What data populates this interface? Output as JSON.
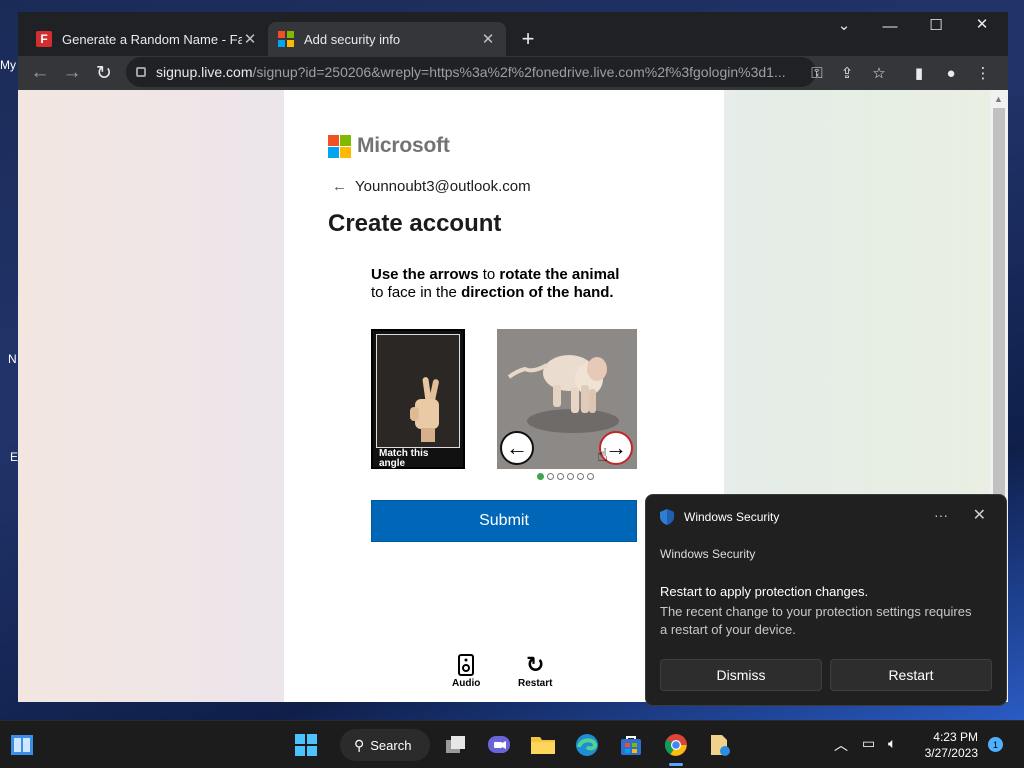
{
  "desktop": {
    "icon_labels": [
      "My",
      "N",
      "E"
    ]
  },
  "browser": {
    "tabs": [
      {
        "title": "Generate a Random Name - Fake",
        "favicon": "fakename-f-icon",
        "active": false
      },
      {
        "title": "Add security info",
        "favicon": "microsoft-icon",
        "active": true
      }
    ],
    "address": {
      "host": "signup.live.com",
      "path": "/signup?id=250206&wreply=https%3a%2f%2fonedrive.live.com%2f%3fgologin%3d1..."
    }
  },
  "page": {
    "brand": "Microsoft",
    "identity": "Younnoubt3@outlook.com",
    "heading": "Create account",
    "puzzle": {
      "instruction_parts": [
        "Use the arrows",
        " to ",
        "rotate the animal",
        "to face in the ",
        "direction of the hand."
      ],
      "match_label": "Match this angle",
      "total_steps": 6,
      "current_step": 1
    },
    "submit_label": "Submit",
    "audio_label": "Audio",
    "restart_label": "Restart"
  },
  "toast": {
    "app": "Windows Security",
    "source": "Windows Security",
    "message": "Restart to apply protection changes.",
    "body": "The recent change to your protection settings requires a restart of your device.",
    "dismiss_label": "Dismiss",
    "restart_label": "Restart"
  },
  "taskbar": {
    "search_label": "Search",
    "time": "4:23 PM",
    "date": "3/27/2023",
    "notification_count": "1"
  },
  "colors": {
    "ms_red": "#f25022",
    "ms_green": "#7fba00",
    "ms_blue": "#00a4ef",
    "ms_yellow": "#ffb900",
    "submit_blue": "#0067b8"
  }
}
